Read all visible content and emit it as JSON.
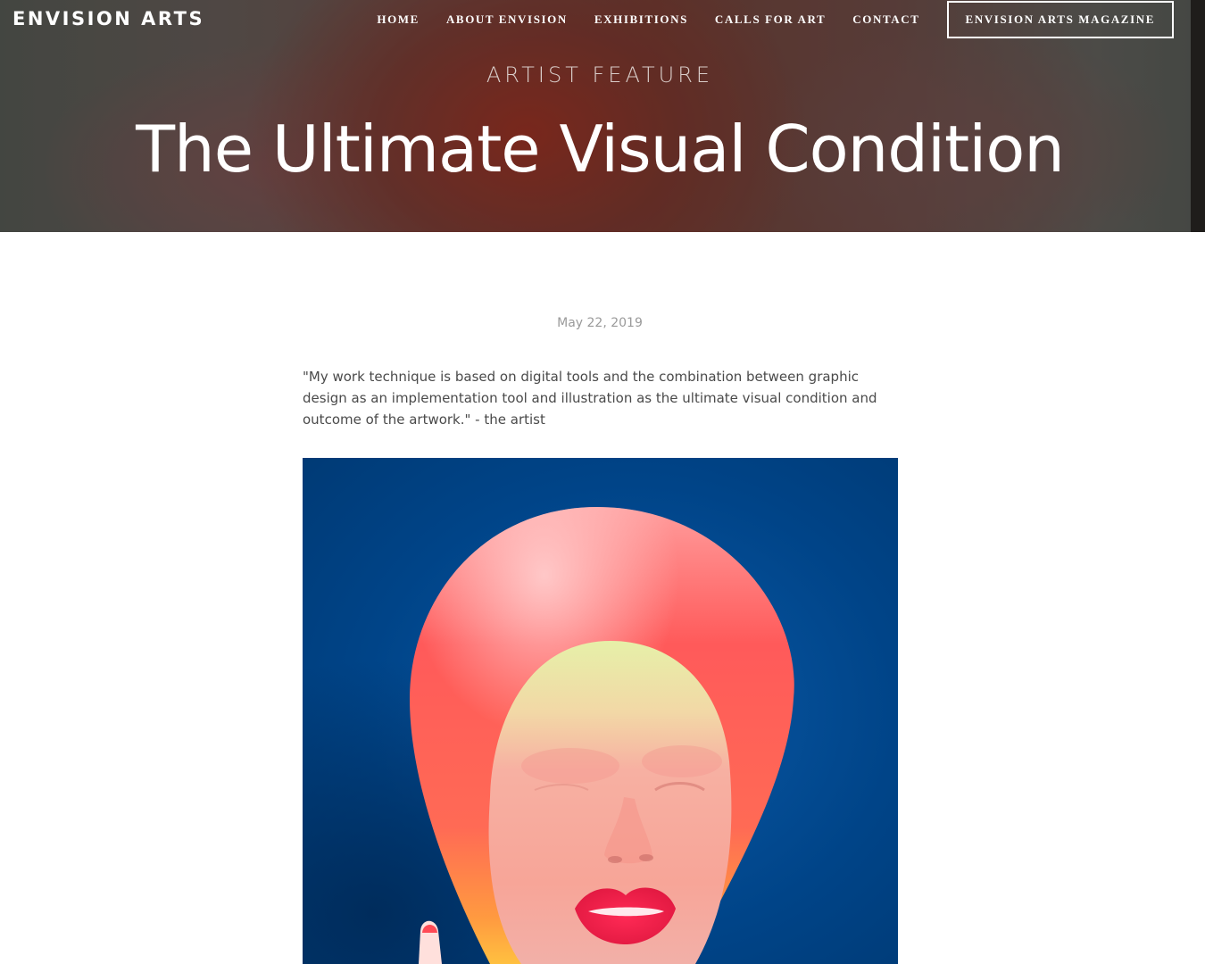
{
  "site": {
    "logo": "ENVISION ARTS"
  },
  "nav": {
    "items": [
      "HOME",
      "ABOUT ENVISION",
      "EXHIBITIONS",
      "CALLS FOR ART",
      "CONTACT"
    ],
    "cta": "ENVISION ARTS MAGAZINE"
  },
  "hero": {
    "eyebrow": "ARTIST FEATURE",
    "title": "The Ultimate Visual Condition"
  },
  "post": {
    "date": "May 22, 2019",
    "quote": "\"My work technique is based on digital tools and the combination between graphic design as an implementation tool and illustration as the ultimate visual condition and outcome of the artwork.\" - the artist"
  },
  "colors": {
    "artwork_background": "#004488",
    "hero_text": "#ffffff",
    "body_text": "#4a4a4a",
    "date_text": "#9a9a9a"
  }
}
